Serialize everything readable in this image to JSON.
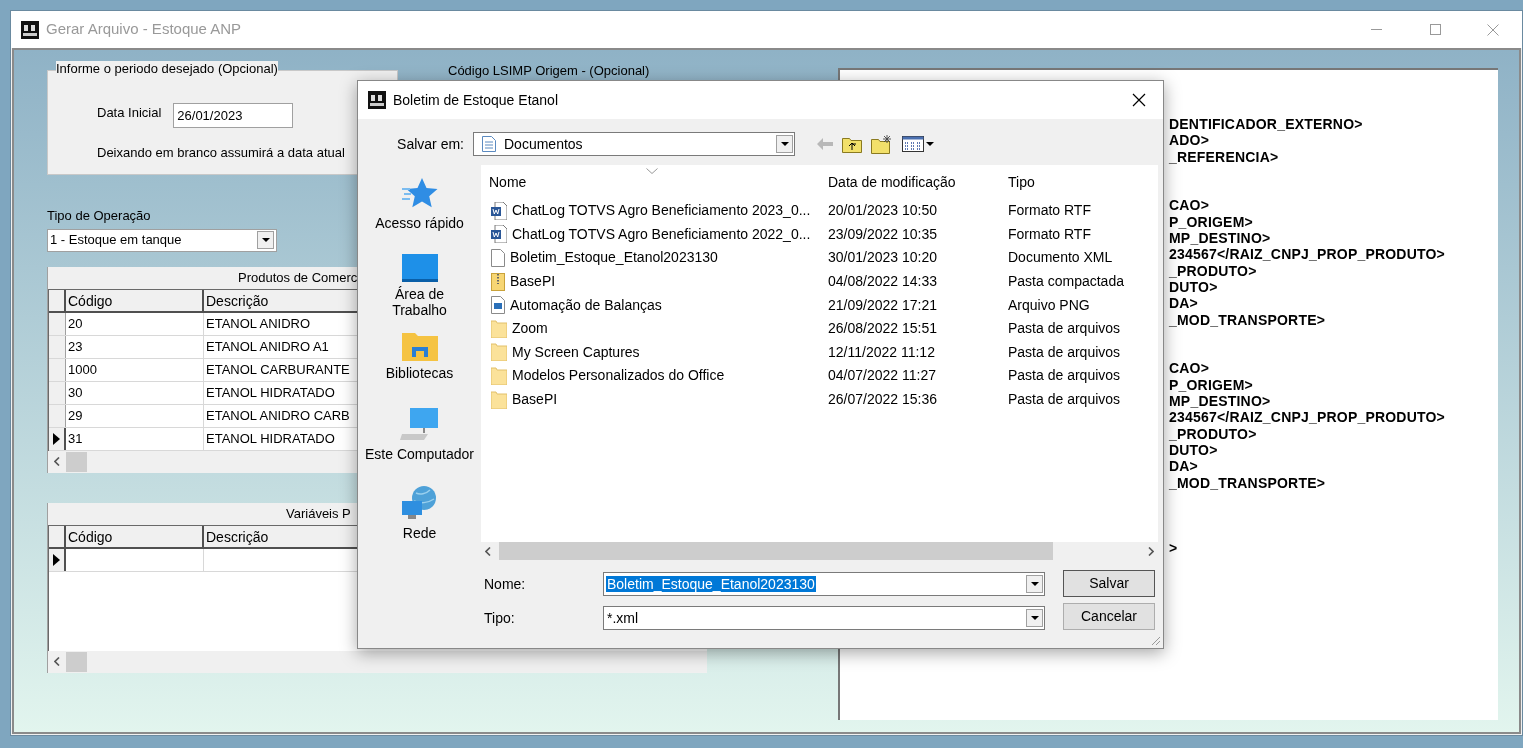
{
  "window": {
    "title": "Gerar Arquivo - Estoque ANP"
  },
  "period_group": {
    "legend": "Informe o periodo desejado (Opcional)",
    "start_label": "Data Inicial",
    "start_value": "26/01/2023",
    "hint": "Deixando em branco assumirá a data atual"
  },
  "lsimp_label": "Código LSIMP Origem - (Opcional)",
  "operation": {
    "label": "Tipo de Operação",
    "value": "1 - Estoque em tanque"
  },
  "products_grid": {
    "caption": "Produtos de Comerc",
    "columns": [
      "Código",
      "Descrição"
    ],
    "rows": [
      {
        "code": "20",
        "description": "ETANOL ANIDRO",
        "selected": false
      },
      {
        "code": "23",
        "description": "ETANOL ANIDRO A1",
        "selected": false
      },
      {
        "code": "1000",
        "description": "ETANOL CARBURANTE",
        "selected": false
      },
      {
        "code": "30",
        "description": "ETANOL HIDRATADO",
        "selected": false
      },
      {
        "code": "29",
        "description": "ETANOL ANIDRO CARB",
        "selected": false
      },
      {
        "code": "31",
        "description": "ETANOL HIDRATADO",
        "selected": true
      }
    ]
  },
  "variables_grid": {
    "caption": "Variáveis P",
    "columns": [
      "Código",
      "Descrição"
    ],
    "rows": [
      {
        "selected": true
      }
    ]
  },
  "xml_preview": {
    "blocks": [
      [
        "DENTIFICADOR_EXTERNO>",
        "ADO>",
        "_REFERENCIA>"
      ],
      [
        "CAO>",
        "P_ORIGEM>",
        "MP_DESTINO>",
        "234567</RAIZ_CNPJ_PROP_PRODUTO>",
        "_PRODUTO>",
        "DUTO>",
        "DA>",
        "_MOD_TRANSPORTE>"
      ],
      [
        "CAO>",
        "P_ORIGEM>",
        "MP_DESTINO>",
        "234567</RAIZ_CNPJ_PROP_PRODUTO>",
        "_PRODUTO>",
        "DUTO>",
        "DA>",
        "_MOD_TRANSPORTE>"
      ],
      [
        ">"
      ]
    ]
  },
  "dialog": {
    "title": "Boletim de Estoque Etanol",
    "save_in_label": "Salvar em:",
    "save_in_value": "Documentos",
    "places": [
      {
        "kind": "star",
        "label": "Acesso rápido"
      },
      {
        "kind": "desktop",
        "label": "Área de Trabalho"
      },
      {
        "kind": "library",
        "label": "Bibliotecas"
      },
      {
        "kind": "computer",
        "label": "Este Computador"
      },
      {
        "kind": "network",
        "label": "Rede"
      }
    ],
    "columns": [
      "Nome",
      "Data de modificação",
      "Tipo"
    ],
    "files": [
      {
        "kind": "word",
        "name": "ChatLog TOTVS Agro Beneficiamento 2023_0...",
        "date": "20/01/2023 10:50",
        "type": "Formato RTF"
      },
      {
        "kind": "word",
        "name": "ChatLog TOTVS Agro Beneficiamento 2022_0...",
        "date": "23/09/2022 10:35",
        "type": "Formato RTF"
      },
      {
        "kind": "blank",
        "name": "Boletim_Estoque_Etanol2023130",
        "date": "30/01/2023 10:20",
        "type": "Documento XML"
      },
      {
        "kind": "zip",
        "name": "BasePI",
        "date": "04/08/2022 14:33",
        "type": "Pasta compactada"
      },
      {
        "kind": "image",
        "name": "Automação de Balanças",
        "date": "21/09/2022 17:21",
        "type": "Arquivo PNG"
      },
      {
        "kind": "folder",
        "name": "Zoom",
        "date": "26/08/2022 15:51",
        "type": "Pasta de arquivos"
      },
      {
        "kind": "folder",
        "name": "My Screen Captures",
        "date": "12/11/2022 11:12",
        "type": "Pasta de arquivos"
      },
      {
        "kind": "folder",
        "name": "Modelos Personalizados do Office",
        "date": "04/07/2022 11:27",
        "type": "Pasta de arquivos"
      },
      {
        "kind": "folder",
        "name": "BasePI",
        "date": "26/07/2022 15:36",
        "type": "Pasta de arquivos"
      }
    ],
    "name_label": "Nome:",
    "name_value": "Boletim_Estoque_Etanol2023130",
    "type_label": "Tipo:",
    "type_value": "*.xml",
    "buttons": [
      "Salvar",
      "Cancelar"
    ]
  }
}
